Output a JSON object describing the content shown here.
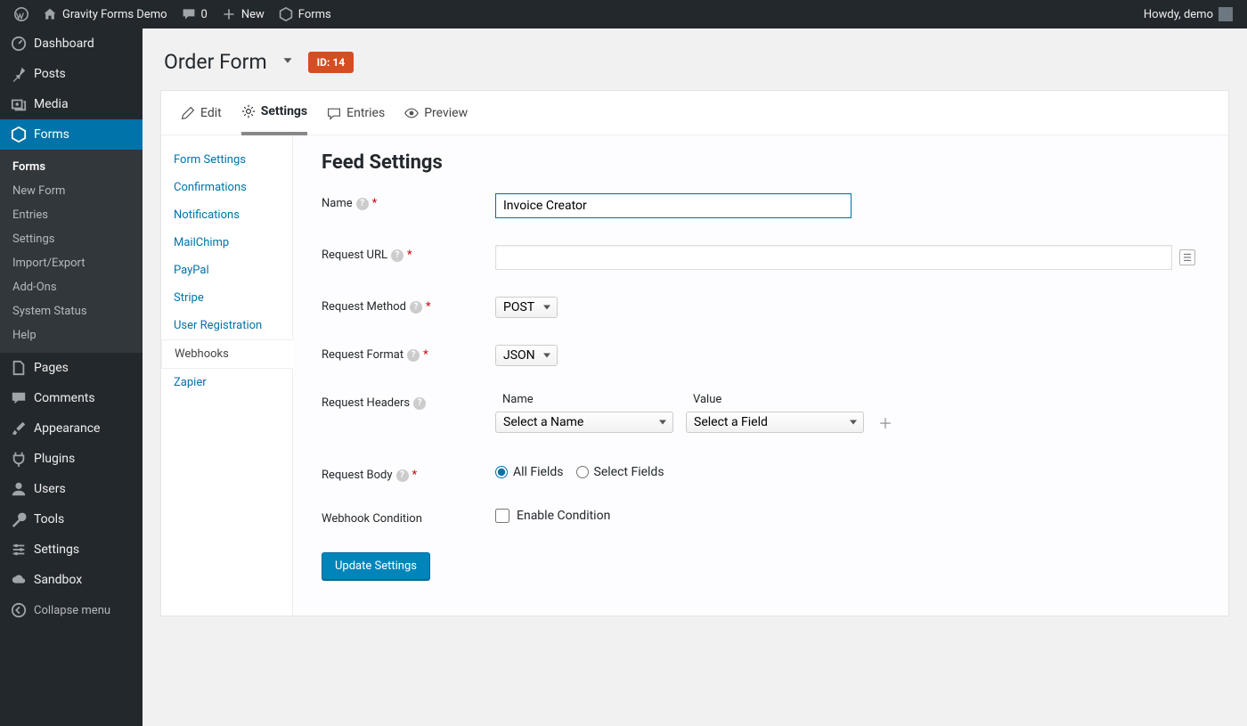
{
  "adminbar": {
    "site_name": "Gravity Forms Demo",
    "comments": "0",
    "new_label": "New",
    "forms_label": "Forms",
    "howdy": "Howdy, demo"
  },
  "wpmenu": {
    "dashboard": "Dashboard",
    "posts": "Posts",
    "media": "Media",
    "forms": "Forms",
    "forms_sub": [
      "Forms",
      "New Form",
      "Entries",
      "Settings",
      "Import/Export",
      "Add-Ons",
      "System Status",
      "Help"
    ],
    "pages": "Pages",
    "comments": "Comments",
    "appearance": "Appearance",
    "plugins": "Plugins",
    "users": "Users",
    "tools": "Tools",
    "settings": "Settings",
    "sandbox": "Sandbox",
    "collapse": "Collapse menu"
  },
  "page": {
    "title": "Order Form",
    "id_badge": "ID: 14"
  },
  "tabs": {
    "edit": "Edit",
    "settings": "Settings",
    "entries": "Entries",
    "preview": "Preview"
  },
  "settings_nav": [
    "Form Settings",
    "Confirmations",
    "Notifications",
    "MailChimp",
    "PayPal",
    "Stripe",
    "User Registration",
    "Webhooks",
    "Zapier"
  ],
  "settings_nav_active": 7,
  "form": {
    "heading": "Feed Settings",
    "name_label": "Name",
    "name_value": "Invoice Creator",
    "url_label": "Request URL",
    "url_value": "",
    "method_label": "Request Method",
    "method_value": "POST",
    "format_label": "Request Format",
    "format_value": "JSON",
    "headers_label": "Request Headers",
    "header_col_name": "Name",
    "header_col_value": "Value",
    "header_name_placeholder": "Select a Name",
    "header_value_placeholder": "Select a Field",
    "body_label": "Request Body",
    "body_all": "All Fields",
    "body_select": "Select Fields",
    "condition_label": "Webhook Condition",
    "condition_check": "Enable Condition",
    "submit": "Update Settings"
  }
}
